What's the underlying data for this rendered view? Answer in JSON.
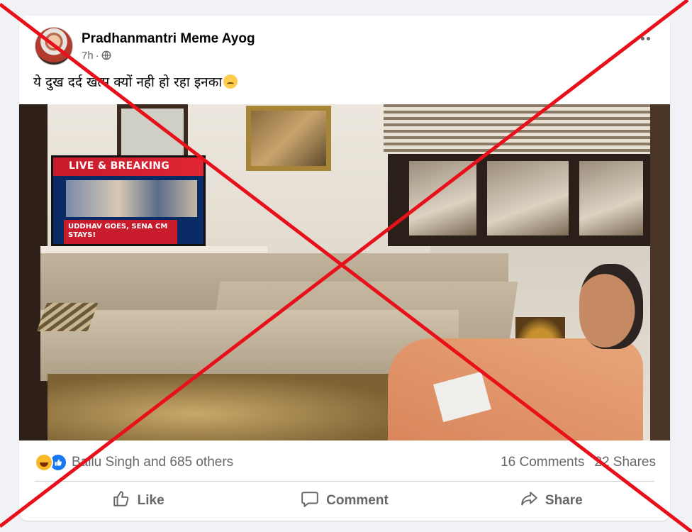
{
  "post": {
    "author": "Pradhanmantri Meme Ayog",
    "time": "7h",
    "separator": "·",
    "privacy_icon": "globe-icon",
    "more_icon": "more-options-icon",
    "caption": "ये दुख दर्द खत्म क्यों नही हो रहा इनका",
    "caption_emoji": "disappointed-face-emoji"
  },
  "image": {
    "tv_header": "LIVE & BREAKING",
    "tv_ticker": "UDDHAV GOES, SENA CM STAYS!"
  },
  "stats": {
    "reaction_icons": [
      "haha-icon",
      "like-icon"
    ],
    "reactions_text": "Ballu Singh and 685 others",
    "comments": "16 Comments",
    "shares": "22 Shares"
  },
  "actions": {
    "like": "Like",
    "comment": "Comment",
    "share": "Share"
  },
  "colors": {
    "overlay_cross": "#e8101a",
    "brand_blue": "#1877f2",
    "secondary_text": "#65676b"
  }
}
